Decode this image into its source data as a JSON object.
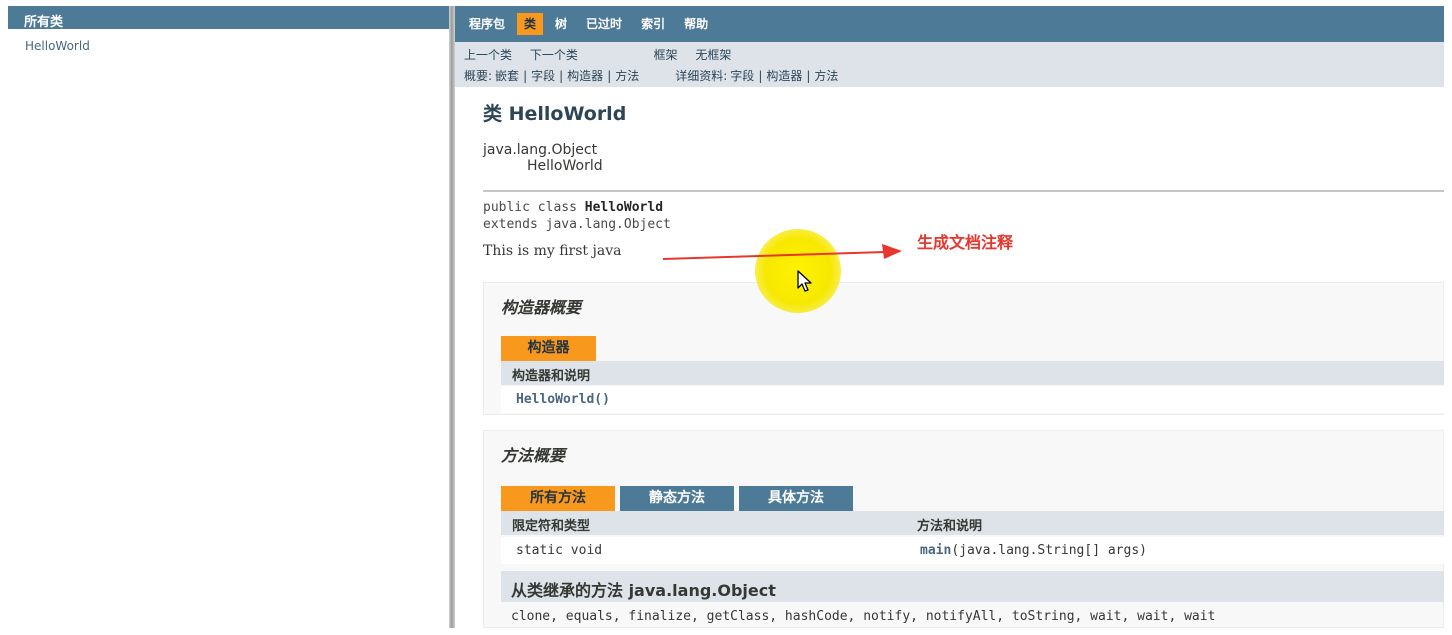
{
  "left_frame": {
    "header": "所有类",
    "classes": [
      "HelloWorld"
    ]
  },
  "top_nav": {
    "items": [
      {
        "label": "程序包",
        "active": false
      },
      {
        "label": "类",
        "active": true
      },
      {
        "label": "树",
        "active": false
      },
      {
        "label": "已过时",
        "active": false
      },
      {
        "label": "索引",
        "active": false
      },
      {
        "label": "帮助",
        "active": false
      }
    ]
  },
  "sub_nav": {
    "prev_class": "上一个类",
    "next_class": "下一个类",
    "frames": "框架",
    "no_frames": "无框架",
    "summary_prefix": "概要:",
    "summary_nested": "嵌套",
    "summary_field": "字段",
    "summary_constr": "构造器",
    "summary_method": "方法",
    "detail_prefix": "详细资料:",
    "detail_field": "字段",
    "detail_constr": "构造器",
    "detail_method": "方法",
    "separator": "|"
  },
  "class_page": {
    "title": "类 HelloWorld",
    "inheritance_root": "java.lang.Object",
    "inheritance_child": "HelloWorld",
    "decl_line1_prefix": "public class ",
    "decl_line1_name": "HelloWorld",
    "decl_line2": "extends java.lang.Object",
    "description": "This is my first java"
  },
  "constructor_summary": {
    "title": "构造器概要",
    "tab": "构造器",
    "column": "构造器和说明",
    "rows": [
      {
        "signature": "HelloWorld()"
      }
    ]
  },
  "method_summary": {
    "title": "方法概要",
    "tabs": [
      {
        "label": "所有方法",
        "active": true
      },
      {
        "label": "静态方法",
        "active": false
      },
      {
        "label": "具体方法",
        "active": false
      }
    ],
    "col_modifier": "限定符和类型",
    "col_method": "方法和说明",
    "rows": [
      {
        "modifier": "static void",
        "method_name": "main",
        "method_params": "(java.lang.String[]  args)"
      }
    ],
    "inherited_title": "从类继承的方法 java.lang.Object",
    "inherited_methods": "clone, equals, finalize, getClass, hashCode, notify, notifyAll, toString, wait, wait, wait"
  },
  "annotation": {
    "label": "生成文档注释",
    "color": "#e8362c"
  },
  "colors": {
    "nav_bg": "#4d7a97",
    "active_tab": "#f8981d",
    "subnav_bg": "#dee3e9",
    "highlight": "#fff200"
  }
}
